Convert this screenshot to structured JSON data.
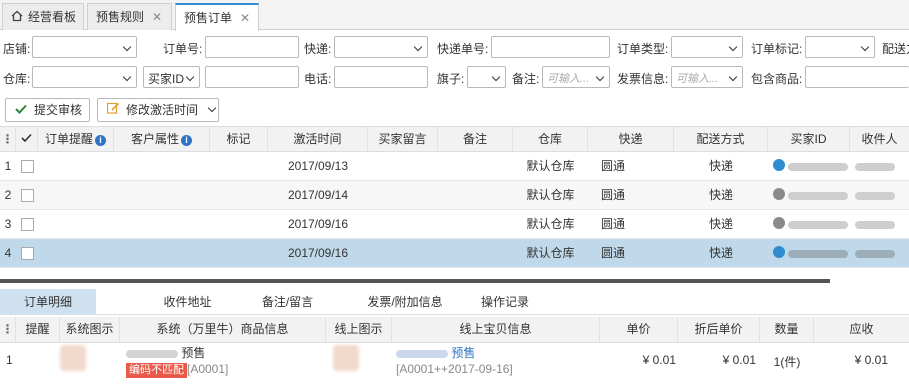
{
  "tabs": [
    {
      "label": "经营看板",
      "closable": false,
      "active": false
    },
    {
      "label": "预售规则",
      "closable": true,
      "active": false
    },
    {
      "label": "预售订单",
      "closable": true,
      "active": true
    }
  ],
  "close_glyph": "✕",
  "filters_row1": {
    "shop_label": "店铺:",
    "order_no_label": "订单号:",
    "express_label": "快递:",
    "tracking_no_label": "快递单号:",
    "order_type_label": "订单类型:",
    "order_flag_label": "订单标记:",
    "delivery_label": "配送方"
  },
  "filters_row2": {
    "warehouse_label": "仓库:",
    "buyer_id_select": "买家ID",
    "phone_label": "电话:",
    "flag_label": "旗子:",
    "remark_label": "备注:",
    "remark_placeholder": "可输入...",
    "invoice_label": "发票信息:",
    "invoice_placeholder": "可输入...",
    "contains_goods_label": "包含商品:"
  },
  "actions": {
    "submit_review": "提交审核",
    "modify_activation_time": "修改激活时间"
  },
  "grid": {
    "columns": [
      "订单提醒",
      "客户属性",
      "标记",
      "激活时间",
      "买家留言",
      "备注",
      "仓库",
      "快递",
      "配送方式",
      "买家ID",
      "收件人"
    ],
    "rows": [
      {
        "num": "1",
        "activation_time": "2017/09/13",
        "warehouse": "默认仓库",
        "express": "圆通",
        "delivery": "快递",
        "buyer_icon_color": "#2e8ccf"
      },
      {
        "num": "2",
        "activation_time": "2017/09/14",
        "warehouse": "默认仓库",
        "express": "圆通",
        "delivery": "快递",
        "buyer_icon_color": "#8a8a8a"
      },
      {
        "num": "3",
        "activation_time": "2017/09/16",
        "warehouse": "默认仓库",
        "express": "圆通",
        "delivery": "快递",
        "buyer_icon_color": "#8a8a8a"
      },
      {
        "num": "4",
        "activation_time": "2017/09/16",
        "warehouse": "默认仓库",
        "express": "圆通",
        "delivery": "快递",
        "buyer_icon_color": "#2e8ccf"
      }
    ],
    "selected_row": 4
  },
  "detail_tabs": [
    {
      "label": "订单明细",
      "active": true
    },
    {
      "label": "收件地址",
      "active": false
    },
    {
      "label": "备注/留言",
      "active": false
    },
    {
      "label": "发票/附加信息",
      "active": false
    },
    {
      "label": "操作记录",
      "active": false
    }
  ],
  "detail": {
    "columns": [
      "提醒",
      "系统图示",
      "系统（万里牛）商品信息",
      "线上图示",
      "线上宝贝信息",
      "单价",
      "折后单价",
      "数量",
      "应收"
    ],
    "row": {
      "num": "1",
      "sys_tag": "预售",
      "mismatch_badge": "编码不匹配",
      "sys_code": "[A0001]",
      "online_tag": "预售",
      "online_code": "[A0001++2017-09-16]",
      "unit_price": "¥ 0.01",
      "discount_price": "¥ 0.01",
      "quantity": "1(件)",
      "receivable": "¥ 0.01"
    }
  },
  "colors": {
    "accent": "#2e8ccf",
    "selected_row": "#bfd8ea",
    "mismatch": "#e85b4b",
    "submit_check": "#2a8a3a",
    "edit_icon": "#e0a030"
  }
}
